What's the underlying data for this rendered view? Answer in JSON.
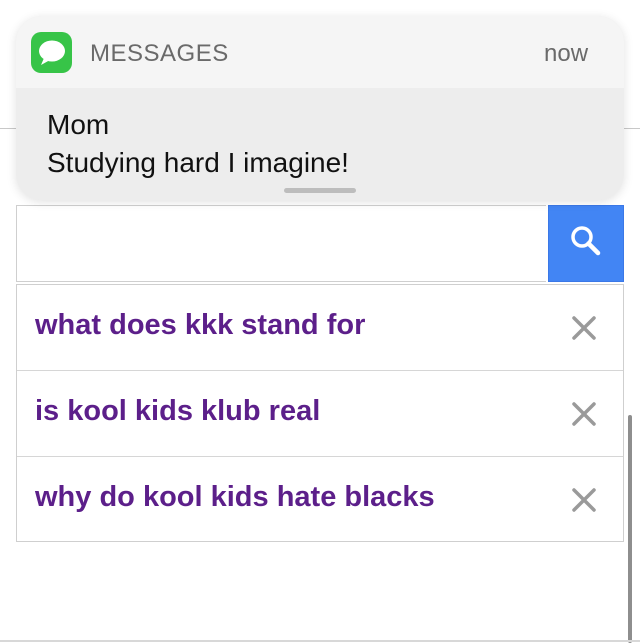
{
  "notification": {
    "app_name": "MESSAGES",
    "time": "now",
    "sender": "Mom",
    "message": "Studying hard I imagine!",
    "icon": "messages-app-icon",
    "accent": "#37c448"
  },
  "search": {
    "value": "",
    "placeholder": "",
    "button_icon": "search-icon",
    "button_color": "#4285f4"
  },
  "suggestions": {
    "color": "#5c1f8a",
    "remove_icon": "close-icon",
    "items": [
      {
        "text": "what does kkk stand for"
      },
      {
        "text": "is kool kids klub real"
      },
      {
        "text": "why do kool kids hate blacks"
      }
    ]
  }
}
